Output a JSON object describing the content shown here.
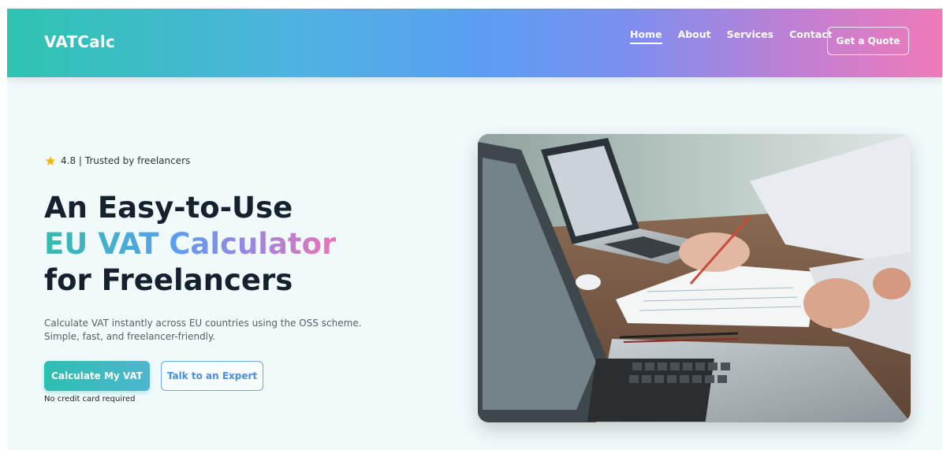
{
  "brand": {
    "name": "VATCalc"
  },
  "nav": {
    "links": [
      {
        "label": "Home",
        "active": true
      },
      {
        "label": "About",
        "active": false
      },
      {
        "label": "Services",
        "active": false
      },
      {
        "label": "Contact",
        "active": false
      }
    ],
    "cta_label": "Get a Quote"
  },
  "hero": {
    "rating_text": "4.8 | Trusted by freelancers",
    "title_line1": "An Easy-to-Use",
    "title_line2": "EU VAT Calculator",
    "title_line3": "for Freelancers",
    "description": "Calculate VAT instantly across EU countries using the OSS scheme. Simple, fast, and freelancer-friendly.",
    "primary_button": "Calculate My VAT",
    "secondary_button": "Talk to an Expert",
    "note": "No credit card required",
    "image_icon": "laptops-desk-photo"
  },
  "colors": {
    "gradient_start": "#2ec4b0",
    "gradient_mid": "#5a9ef2",
    "gradient_end": "#f07ab8",
    "star": "#f4b400",
    "heading": "#16212e"
  }
}
